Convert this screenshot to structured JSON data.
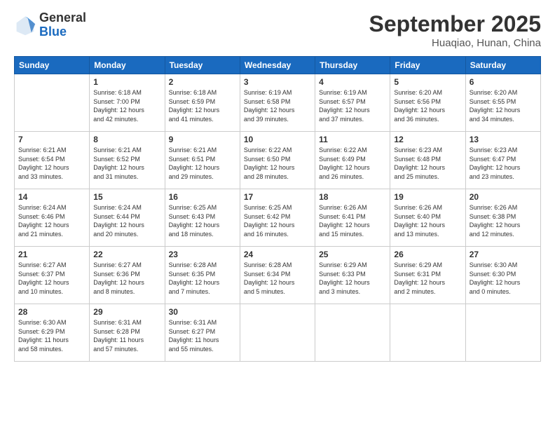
{
  "header": {
    "logo": {
      "general": "General",
      "blue": "Blue"
    },
    "title": "September 2025",
    "location": "Huaqiao, Hunan, China"
  },
  "calendar": {
    "days_of_week": [
      "Sunday",
      "Monday",
      "Tuesday",
      "Wednesday",
      "Thursday",
      "Friday",
      "Saturday"
    ],
    "weeks": [
      [
        {
          "day": "",
          "info": ""
        },
        {
          "day": "1",
          "info": "Sunrise: 6:18 AM\nSunset: 7:00 PM\nDaylight: 12 hours\nand 42 minutes."
        },
        {
          "day": "2",
          "info": "Sunrise: 6:18 AM\nSunset: 6:59 PM\nDaylight: 12 hours\nand 41 minutes."
        },
        {
          "day": "3",
          "info": "Sunrise: 6:19 AM\nSunset: 6:58 PM\nDaylight: 12 hours\nand 39 minutes."
        },
        {
          "day": "4",
          "info": "Sunrise: 6:19 AM\nSunset: 6:57 PM\nDaylight: 12 hours\nand 37 minutes."
        },
        {
          "day": "5",
          "info": "Sunrise: 6:20 AM\nSunset: 6:56 PM\nDaylight: 12 hours\nand 36 minutes."
        },
        {
          "day": "6",
          "info": "Sunrise: 6:20 AM\nSunset: 6:55 PM\nDaylight: 12 hours\nand 34 minutes."
        }
      ],
      [
        {
          "day": "7",
          "info": "Sunrise: 6:21 AM\nSunset: 6:54 PM\nDaylight: 12 hours\nand 33 minutes."
        },
        {
          "day": "8",
          "info": "Sunrise: 6:21 AM\nSunset: 6:52 PM\nDaylight: 12 hours\nand 31 minutes."
        },
        {
          "day": "9",
          "info": "Sunrise: 6:21 AM\nSunset: 6:51 PM\nDaylight: 12 hours\nand 29 minutes."
        },
        {
          "day": "10",
          "info": "Sunrise: 6:22 AM\nSunset: 6:50 PM\nDaylight: 12 hours\nand 28 minutes."
        },
        {
          "day": "11",
          "info": "Sunrise: 6:22 AM\nSunset: 6:49 PM\nDaylight: 12 hours\nand 26 minutes."
        },
        {
          "day": "12",
          "info": "Sunrise: 6:23 AM\nSunset: 6:48 PM\nDaylight: 12 hours\nand 25 minutes."
        },
        {
          "day": "13",
          "info": "Sunrise: 6:23 AM\nSunset: 6:47 PM\nDaylight: 12 hours\nand 23 minutes."
        }
      ],
      [
        {
          "day": "14",
          "info": "Sunrise: 6:24 AM\nSunset: 6:46 PM\nDaylight: 12 hours\nand 21 minutes."
        },
        {
          "day": "15",
          "info": "Sunrise: 6:24 AM\nSunset: 6:44 PM\nDaylight: 12 hours\nand 20 minutes."
        },
        {
          "day": "16",
          "info": "Sunrise: 6:25 AM\nSunset: 6:43 PM\nDaylight: 12 hours\nand 18 minutes."
        },
        {
          "day": "17",
          "info": "Sunrise: 6:25 AM\nSunset: 6:42 PM\nDaylight: 12 hours\nand 16 minutes."
        },
        {
          "day": "18",
          "info": "Sunrise: 6:26 AM\nSunset: 6:41 PM\nDaylight: 12 hours\nand 15 minutes."
        },
        {
          "day": "19",
          "info": "Sunrise: 6:26 AM\nSunset: 6:40 PM\nDaylight: 12 hours\nand 13 minutes."
        },
        {
          "day": "20",
          "info": "Sunrise: 6:26 AM\nSunset: 6:38 PM\nDaylight: 12 hours\nand 12 minutes."
        }
      ],
      [
        {
          "day": "21",
          "info": "Sunrise: 6:27 AM\nSunset: 6:37 PM\nDaylight: 12 hours\nand 10 minutes."
        },
        {
          "day": "22",
          "info": "Sunrise: 6:27 AM\nSunset: 6:36 PM\nDaylight: 12 hours\nand 8 minutes."
        },
        {
          "day": "23",
          "info": "Sunrise: 6:28 AM\nSunset: 6:35 PM\nDaylight: 12 hours\nand 7 minutes."
        },
        {
          "day": "24",
          "info": "Sunrise: 6:28 AM\nSunset: 6:34 PM\nDaylight: 12 hours\nand 5 minutes."
        },
        {
          "day": "25",
          "info": "Sunrise: 6:29 AM\nSunset: 6:33 PM\nDaylight: 12 hours\nand 3 minutes."
        },
        {
          "day": "26",
          "info": "Sunrise: 6:29 AM\nSunset: 6:31 PM\nDaylight: 12 hours\nand 2 minutes."
        },
        {
          "day": "27",
          "info": "Sunrise: 6:30 AM\nSunset: 6:30 PM\nDaylight: 12 hours\nand 0 minutes."
        }
      ],
      [
        {
          "day": "28",
          "info": "Sunrise: 6:30 AM\nSunset: 6:29 PM\nDaylight: 11 hours\nand 58 minutes."
        },
        {
          "day": "29",
          "info": "Sunrise: 6:31 AM\nSunset: 6:28 PM\nDaylight: 11 hours\nand 57 minutes."
        },
        {
          "day": "30",
          "info": "Sunrise: 6:31 AM\nSunset: 6:27 PM\nDaylight: 11 hours\nand 55 minutes."
        },
        {
          "day": "",
          "info": ""
        },
        {
          "day": "",
          "info": ""
        },
        {
          "day": "",
          "info": ""
        },
        {
          "day": "",
          "info": ""
        }
      ]
    ]
  }
}
